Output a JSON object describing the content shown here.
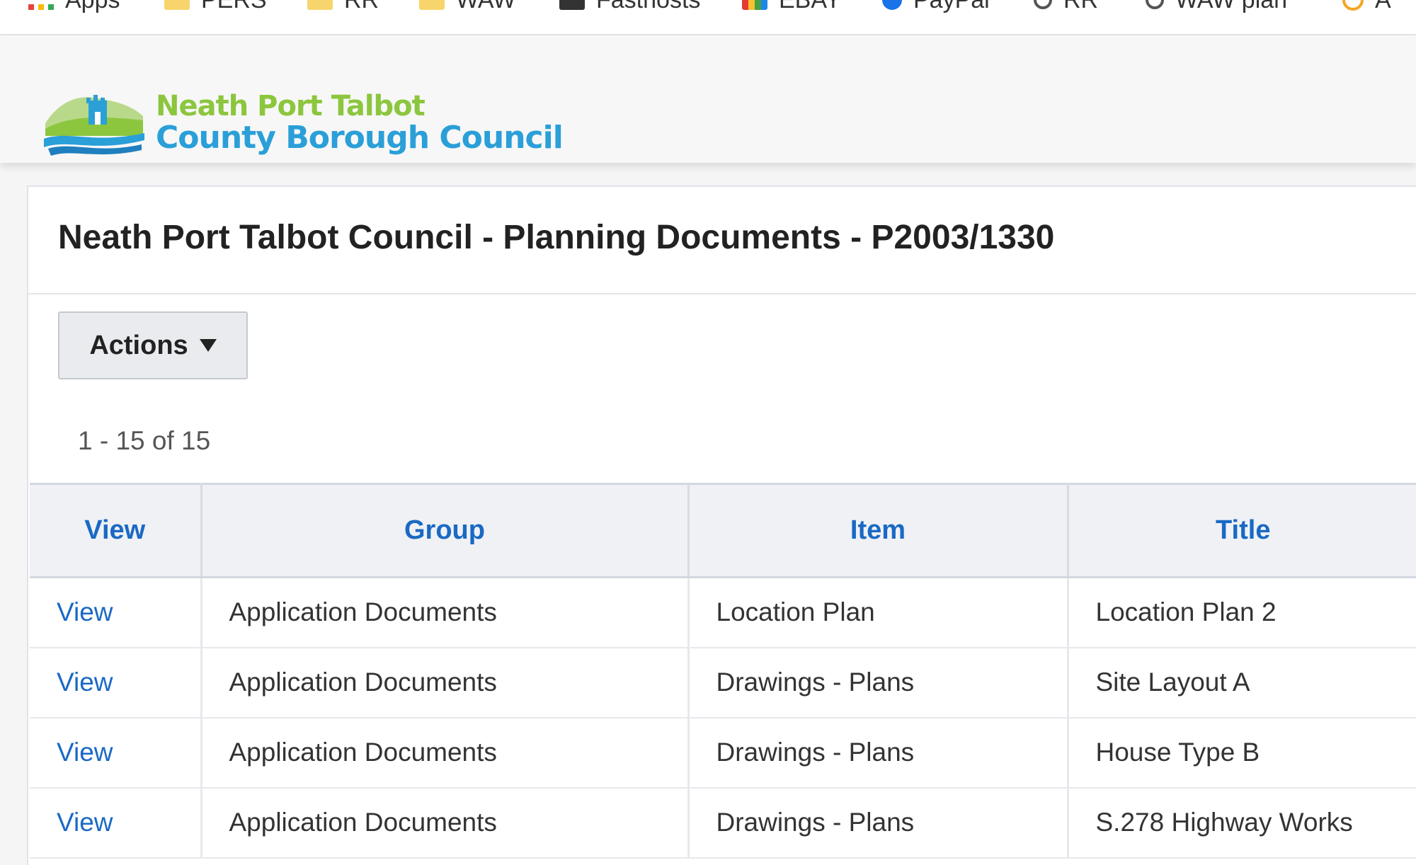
{
  "bookmarks": [
    {
      "label": "Apps",
      "icon": "apps-grid-icon"
    },
    {
      "label": "PERS",
      "icon": "folder-icon"
    },
    {
      "label": "RR",
      "icon": "folder-icon"
    },
    {
      "label": "WAW",
      "icon": "folder-icon"
    },
    {
      "label": "Fasthosts",
      "icon": "fasthosts-icon"
    },
    {
      "label": "EBAY",
      "icon": "ebay-icon"
    },
    {
      "label": "PayPal",
      "icon": "paypal-icon"
    },
    {
      "label": "RR",
      "icon": "globe-icon"
    },
    {
      "label": "WAW plan",
      "icon": "globe-icon"
    },
    {
      "label": "A",
      "icon": "amazon-icon"
    }
  ],
  "header": {
    "logo_line1": "Neath Port Talbot",
    "logo_line2": "County Borough Council"
  },
  "page": {
    "title": "Neath Port Talbot Council - Planning Documents - P2003/1330",
    "actions_label": "Actions",
    "pagination": "1 - 15 of 15"
  },
  "table": {
    "columns": [
      "View",
      "Group",
      "Item",
      "Title"
    ],
    "rows": [
      {
        "view": "View",
        "group": "Application Documents",
        "item": "Location Plan",
        "title": "Location Plan 2"
      },
      {
        "view": "View",
        "group": "Application Documents",
        "item": "Drawings - Plans",
        "title": "Site Layout A"
      },
      {
        "view": "View",
        "group": "Application Documents",
        "item": "Drawings - Plans",
        "title": "House Type B"
      },
      {
        "view": "View",
        "group": "Application Documents",
        "item": "Drawings - Plans",
        "title": "S.278 Highway Works"
      }
    ]
  },
  "colors": {
    "link": "#1a69c4",
    "logo_green": "#8cc63e",
    "logo_blue": "#2a9fd8"
  }
}
